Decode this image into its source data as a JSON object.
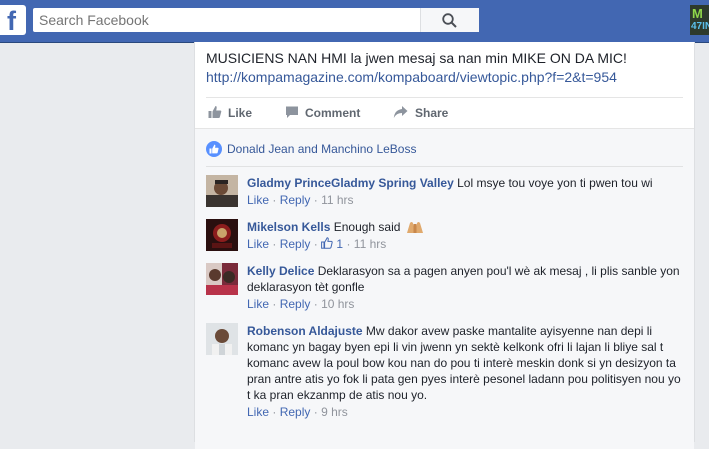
{
  "search": {
    "placeholder": "Search Facebook"
  },
  "brand": {
    "logo_letter": "f",
    "badge_top": "M",
    "badge_bottom": "47IN"
  },
  "post": {
    "text": "MUSICIENS NAN HMI la jwen mesaj sa nan min MIKE ON DA MIC!",
    "link": "http://kompamagazine.com/kompaboard/viewtopic.php?f=2&t=954",
    "actions": {
      "like": "Like",
      "comment": "Comment",
      "share": "Share"
    }
  },
  "likes_summary": "Donald Jean and Manchino LeBoss",
  "comments": [
    {
      "author": "Gladmy PrinceGladmy Spring Valley",
      "text": "Lol msye tou voye yon ti pwen tou wi",
      "like": "Like",
      "reply": "Reply",
      "sep": "·",
      "time": "11 hrs"
    },
    {
      "author": "Mikelson Kells",
      "text": "Enough said",
      "emoji": "folded-hands-emoji",
      "like": "Like",
      "reply": "Reply",
      "sep": "·",
      "reactions": "1",
      "time": "11 hrs"
    },
    {
      "author": "Kelly Delice",
      "text": "Deklarasyon sa a pagen anyen pou'l wè ak mesaj , li plis sanble yon deklarasyon tèt gonfle",
      "like": "Like",
      "reply": "Reply",
      "sep": "·",
      "time": "10 hrs"
    },
    {
      "author": "Robenson Aldajuste",
      "text": "Mw dakor avew paske mantalite ayisyenne nan depi li komanc yn bagay byen epi li vin jwenn yn sektè kelkonk ofri li lajan li bliye sal t komanc avew la poul bow kou nan do pou ti interè meskin donk si yn desizyon ta pran antre atis yo fok li pata gen pyes interè pesonel ladann pou politisyen nou yo t ka pran ekzanmp de atis nou yo.",
      "like": "Like",
      "reply": "Reply",
      "sep": "·",
      "time": "9 hrs"
    }
  ],
  "colors": {
    "topbar": "#4267b2",
    "link": "#365899",
    "background": "#e9ebee"
  }
}
